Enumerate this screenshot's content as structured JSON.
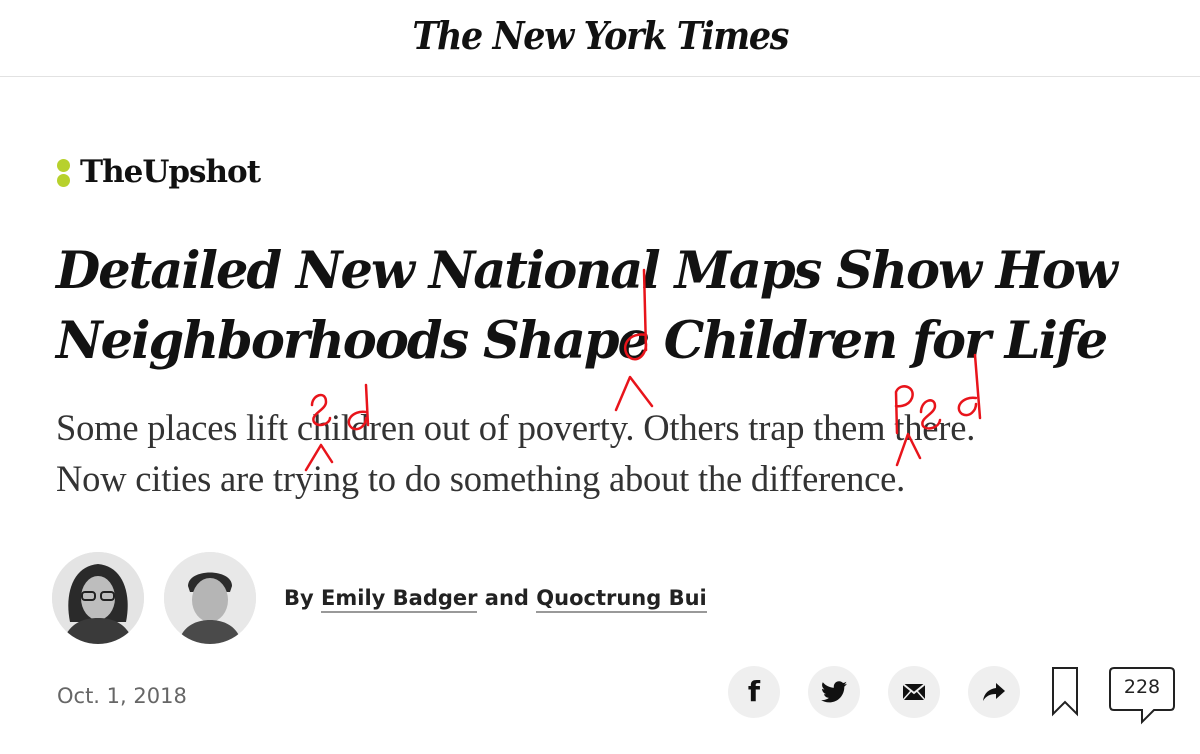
{
  "masthead": {
    "title": "The New York Times"
  },
  "section": {
    "name": "TheUpshot"
  },
  "article": {
    "headline_lines": [
      "Detailed New National Maps Show How",
      "Neighborhoods Shape Children for Life"
    ],
    "summary_lines": [
      "Some places lift children out of poverty. Others trap them there.",
      "Now cities are trying to do something about the difference."
    ],
    "byline": {
      "prefix": "By",
      "author1": "Emily Badger",
      "conjunction": "and",
      "author2": "Quoctrung Bui"
    },
    "date": "Oct. 1, 2018"
  },
  "annotations": {
    "color": "#e8141b",
    "handwritten_edits": [
      "ed",
      "d",
      "ped"
    ]
  },
  "share": {
    "icons": [
      "facebook-icon",
      "twitter-icon",
      "email-icon",
      "share-arrow-icon",
      "bookmark-icon",
      "comment-icon"
    ],
    "comment_count": "228"
  },
  "colors": {
    "upshot_green": "#b7d12d",
    "text": "#121212",
    "summary_text": "#333333",
    "date_text": "#666666",
    "button_bg": "#efefef"
  }
}
